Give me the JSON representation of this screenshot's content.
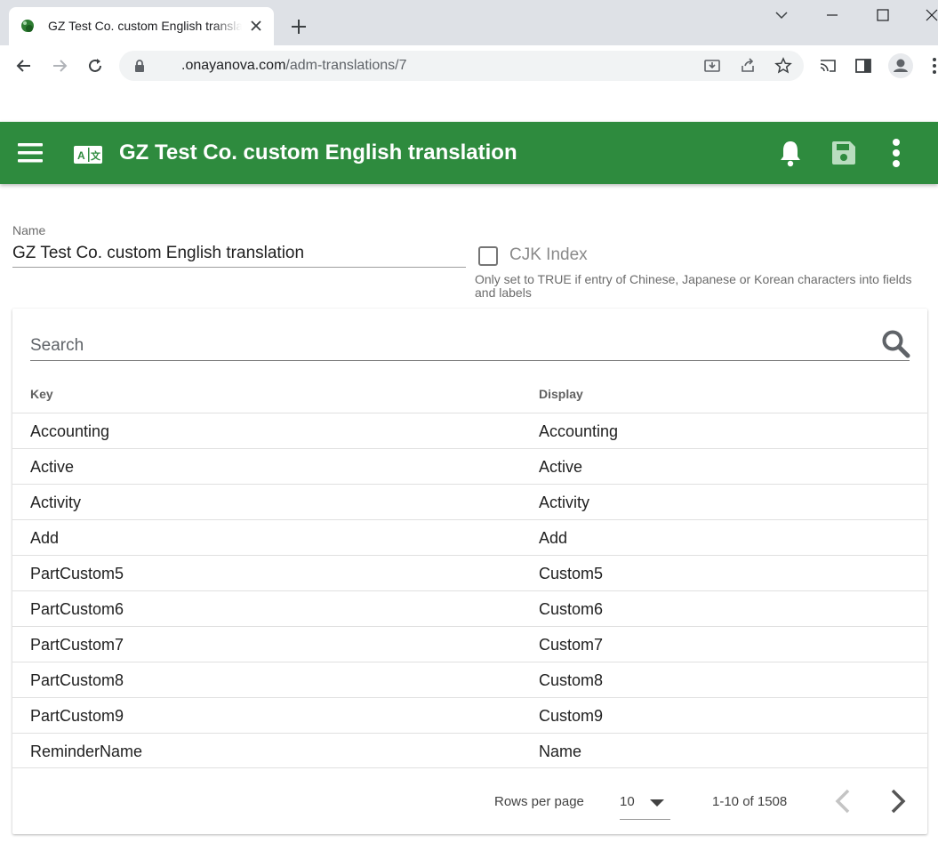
{
  "browser": {
    "tab_title": "GZ Test Co. custom English translation",
    "url_domain": ".onayanova.com",
    "url_path": "/adm-translations/7"
  },
  "appbar": {
    "title": "GZ Test Co. custom English translation",
    "color": "#2e8b3e",
    "icons": [
      "menu-icon",
      "translate-icon",
      "bell-icon",
      "save-icon",
      "kebab-menu-icon"
    ]
  },
  "form": {
    "name_label": "Name",
    "name_value": "GZ Test Co. custom English translation",
    "cjk_label": "CJK Index",
    "cjk_checked": false,
    "cjk_hint": "Only set to TRUE if entry of Chinese, Japanese or Korean characters into fields and labels"
  },
  "table": {
    "search_placeholder": "Search",
    "columns": [
      "Key",
      "Display"
    ],
    "rows": [
      [
        "Accounting",
        "Accounting"
      ],
      [
        "Active",
        "Active"
      ],
      [
        "Activity",
        "Activity"
      ],
      [
        "Add",
        "Add"
      ],
      [
        "PartCustom5",
        "Custom5"
      ],
      [
        "PartCustom6",
        "Custom6"
      ],
      [
        "PartCustom7",
        "Custom7"
      ],
      [
        "PartCustom8",
        "Custom8"
      ],
      [
        "PartCustom9",
        "Custom9"
      ],
      [
        "ReminderName",
        "Name"
      ]
    ],
    "footer": {
      "rows_per_page_label": "Rows per page",
      "rows_per_page_value": "10",
      "page_info": "1-10 of 1508"
    }
  }
}
